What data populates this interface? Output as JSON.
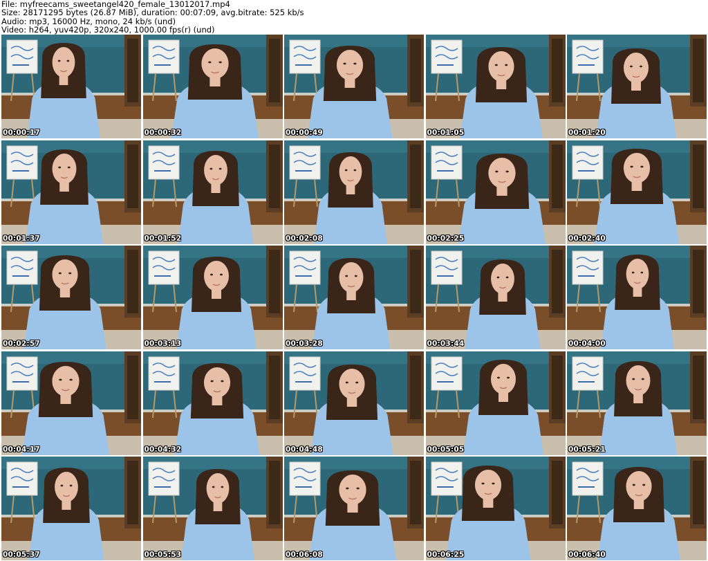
{
  "info": {
    "file_line": "File: myfreecams_sweetangel420_female_13012017.mp4",
    "size_line": "Size: 28171295 bytes (26.87 MiB), duration: 00:07:09, avg.bitrate: 525 kb/s",
    "audio_line": "Audio: mp3, 16000 Hz, mono, 24 kb/s (und)",
    "video_line": "Video: h264, yuv420p, 320x240, 1000.00 fps(r) (und)"
  },
  "colors": {
    "wall": "#2c6878",
    "wall_light": "#3d8393",
    "floor": "#7a4e28",
    "sweater": "#9cc4e8",
    "hair": "#3a2519",
    "skin": "#e6bfa6",
    "bed": "#d8d4c4"
  },
  "thumbnails": [
    {
      "timestamp": "00:00:17"
    },
    {
      "timestamp": "00:00:32"
    },
    {
      "timestamp": "00:00:49"
    },
    {
      "timestamp": "00:01:05"
    },
    {
      "timestamp": "00:01:20"
    },
    {
      "timestamp": "00:01:37"
    },
    {
      "timestamp": "00:01:52"
    },
    {
      "timestamp": "00:02:08"
    },
    {
      "timestamp": "00:02:25"
    },
    {
      "timestamp": "00:02:40"
    },
    {
      "timestamp": "00:02:57"
    },
    {
      "timestamp": "00:03:13"
    },
    {
      "timestamp": "00:03:28"
    },
    {
      "timestamp": "00:03:44"
    },
    {
      "timestamp": "00:04:00"
    },
    {
      "timestamp": "00:04:17"
    },
    {
      "timestamp": "00:04:32"
    },
    {
      "timestamp": "00:04:48"
    },
    {
      "timestamp": "00:05:05"
    },
    {
      "timestamp": "00:05:21"
    },
    {
      "timestamp": "00:05:37"
    },
    {
      "timestamp": "00:05:53"
    },
    {
      "timestamp": "00:06:08"
    },
    {
      "timestamp": "00:06:25"
    },
    {
      "timestamp": "00:06:40"
    }
  ]
}
